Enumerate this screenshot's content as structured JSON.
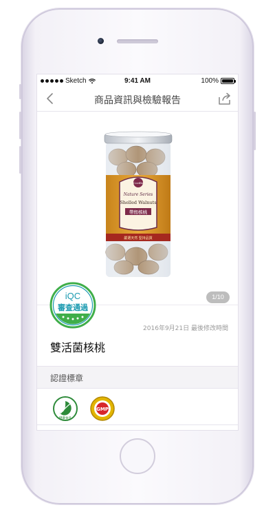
{
  "status_bar": {
    "carrier": "Sketch",
    "time": "9:41 AM",
    "battery": "100%",
    "battery_level": 1.0
  },
  "nav": {
    "title": "商品資訊與檢驗報告",
    "back_icon": "chevron-left-icon",
    "share_icon": "share-icon"
  },
  "product": {
    "image_label": "product-image",
    "image_text": {
      "brand": "Coville",
      "series": "Nature Series",
      "name_en": "Shelled Walnuts",
      "name_zh": "帶殼核桃",
      "banner": "嚴選天然 堅持品質"
    },
    "page_indicator": "1/10",
    "badge": {
      "latin": "iQC",
      "cjk": "審查通過"
    },
    "last_modified": "2016年9月21日 最後修改時間",
    "name": "雙活菌核桃"
  },
  "certification": {
    "section_title": "認證標章",
    "badges": [
      {
        "name": "health-food-badge",
        "color": "#2e8b3a",
        "text": "健康食品"
      },
      {
        "name": "gmp-badge",
        "color": "#e2b500",
        "text": "GMP"
      }
    ]
  },
  "colors": {
    "accent": "#1a9ab0",
    "badge_green": "#3fae49",
    "nav_title": "#444444"
  }
}
